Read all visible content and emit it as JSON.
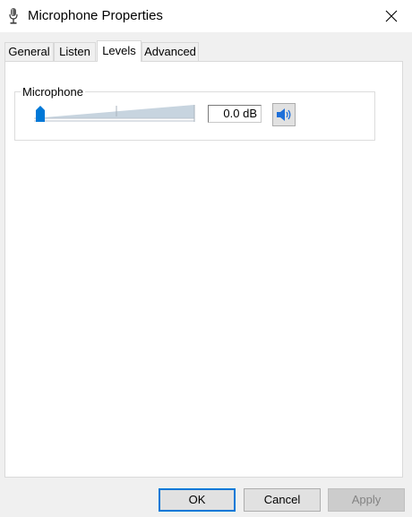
{
  "window": {
    "title": "Microphone Properties"
  },
  "tabs": [
    {
      "label": "General"
    },
    {
      "label": "Listen"
    },
    {
      "label": "Levels"
    },
    {
      "label": "Advanced"
    }
  ],
  "levels": {
    "group_label": "Microphone",
    "slider_value_fraction": 0,
    "db_value": "0.0 dB",
    "mute_icon": "speaker-icon"
  },
  "buttons": {
    "ok": "OK",
    "cancel": "Cancel",
    "apply": "Apply"
  },
  "colors": {
    "accent": "#0078d7",
    "thumb": "#0078d7",
    "track": "#c7d4df"
  }
}
